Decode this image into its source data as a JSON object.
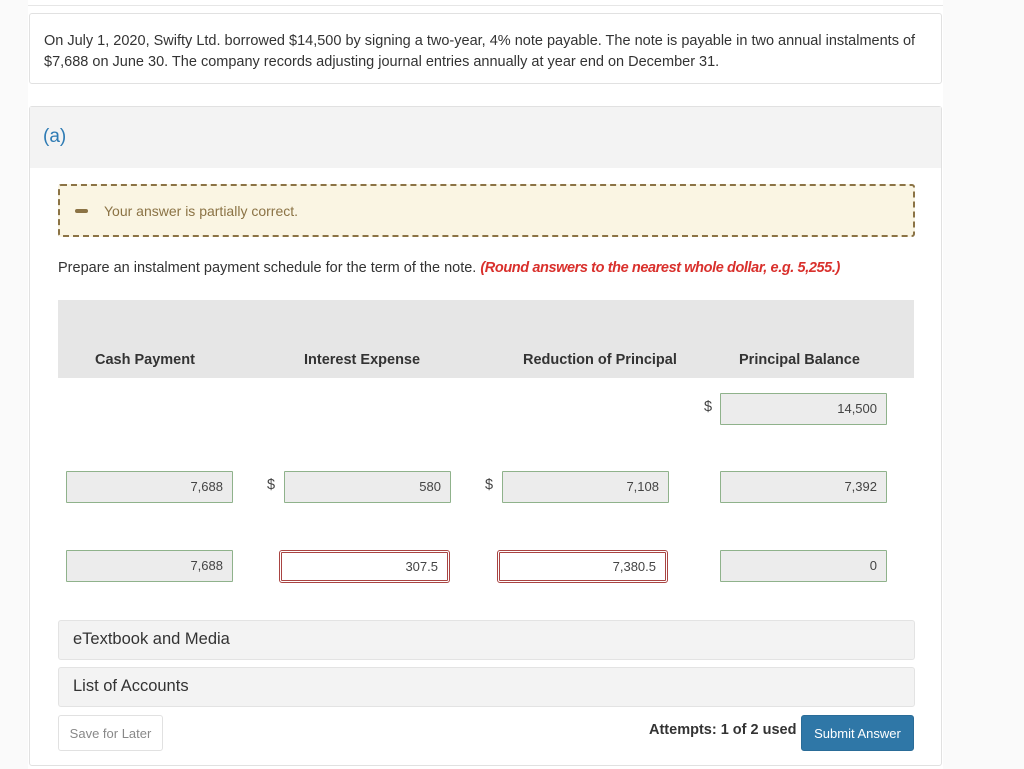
{
  "question": {
    "text": "On July 1, 2020, Swifty Ltd. borrowed $14,500 by signing a two-year, 4% note payable. The note is payable in two annual instalments of $7,688 on June 30. The company records adjusting journal entries annually at year end on December 31."
  },
  "part": {
    "label": "(a)",
    "feedback": {
      "icon": "partial-dash-icon",
      "text": "Your answer is partially correct.",
      "color": "#8b7345"
    },
    "instructions": "Prepare an instalment payment schedule for the term of the note.",
    "rounding_note": "(Round answers to the nearest whole dollar, e.g. 5,255.)",
    "table": {
      "headers": [
        "Cash Payment",
        "Interest Expense",
        "Reduction of Principal",
        "Principal Balance"
      ],
      "currency_symbol": "$",
      "opening_balance": {
        "value": "14,500",
        "status": "correct"
      },
      "rows": [
        {
          "cash_payment": {
            "value": "7,688",
            "status": "correct"
          },
          "interest_expense": {
            "value": "580",
            "status": "correct"
          },
          "reduction_of_principal": {
            "value": "7,108",
            "status": "correct"
          },
          "principal_balance": {
            "value": "7,392",
            "status": "correct"
          }
        },
        {
          "cash_payment": {
            "value": "7,688",
            "status": "correct"
          },
          "interest_expense": {
            "value": "307.5",
            "status": "incorrect"
          },
          "reduction_of_principal": {
            "value": "7,380.5",
            "status": "incorrect"
          },
          "principal_balance": {
            "value": "0",
            "status": "correct"
          }
        }
      ]
    }
  },
  "resources": {
    "etextbook_label": "eTextbook and Media",
    "accounts_label": "List of Accounts"
  },
  "footer": {
    "save_label": "Save for Later",
    "attempts_text": "Attempts: 1 of 2 used",
    "submit_label": "Submit Answer"
  },
  "colors": {
    "accent": "#2f77a7",
    "part_label": "#2e7bb4",
    "error": "#a94442",
    "note_red": "#d9302c",
    "correct_border": "#8fb28b"
  }
}
